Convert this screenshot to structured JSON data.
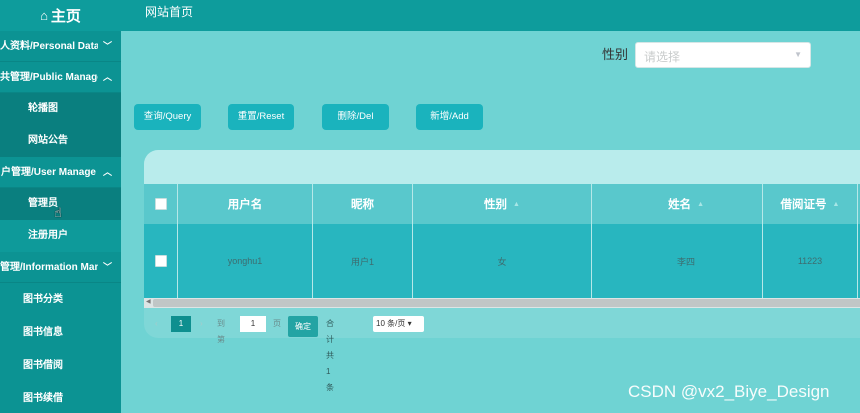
{
  "header": {
    "brand": "主页",
    "nav_link": "网站首页"
  },
  "icons": {
    "home": "home-icon",
    "chevron_down": "chevron-down-icon",
    "chevron_up": "chevron-up-icon"
  },
  "sidebar": {
    "groups": [
      {
        "label": "人资料/Personal Data",
        "chevron": "down"
      },
      {
        "label": "共管理/Public Manage",
        "chevron": "up",
        "items": [
          "轮播图",
          "网站公告"
        ]
      },
      {
        "label": "户管理/User Manage",
        "chevron": "up",
        "items": [
          "管理员",
          "注册用户"
        ]
      },
      {
        "label": "管理/Information Manage",
        "chevron": "down",
        "items": [
          "图书分类",
          "图书信息",
          "图书借阅",
          "图书续借"
        ]
      }
    ]
  },
  "filter": {
    "label": "性别",
    "placeholder": "请选择"
  },
  "toolbar": {
    "query": "查询/Query",
    "reset": "重置/Reset",
    "delete": "删除/Del",
    "add": "新增/Add"
  },
  "table": {
    "headers": [
      "用户名",
      "昵称",
      "性别",
      "姓名",
      "借阅证号"
    ],
    "rows": [
      [
        "yonghu1",
        "用户1",
        "女",
        "李四",
        "11223"
      ]
    ]
  },
  "pagination": {
    "current_page": "1",
    "goto_prefix": "到第",
    "goto_value": "1",
    "goto_suffix": "页",
    "confirm": "确定",
    "total": "合计共 1 条",
    "page_size": "10 条/页"
  },
  "watermark": "CSDN @vx2_Biye_Design",
  "colors": {
    "topbar": "#0e9c9c",
    "sidebar": "#0c9393",
    "content_bg": "#6fd3d3",
    "button": "#1ab3bd",
    "table_body": "#28b6bf"
  }
}
